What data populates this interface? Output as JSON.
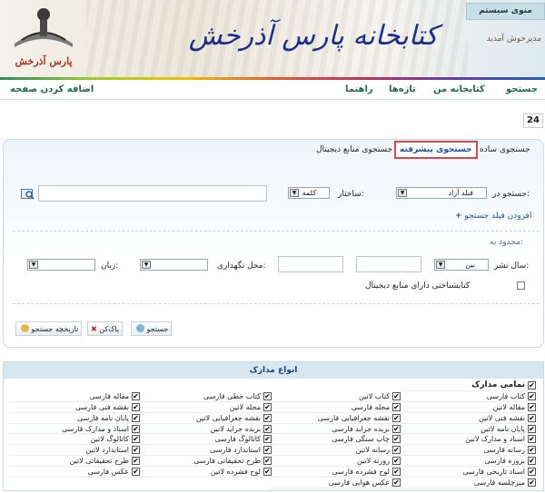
{
  "header": {
    "brand_title": "کتابخانه پارس آذرخش",
    "logo_text": "پارس آذرخش",
    "system_menu": "منوی سیستم",
    "welcome": "مدیرخوش آمدید"
  },
  "nav": {
    "search": "جستجو",
    "my_library": "کتابخانه من",
    "news": "تازه‌ها",
    "guide": "راهنما",
    "add_page": "اضافه کردن صفحه"
  },
  "page_number": "24",
  "search": {
    "tabs": {
      "simple": "جستجوی ساده",
      "advanced": "جستجوی پیشرفته",
      "digital": "جستجوی منابع دیجیتال"
    },
    "search_in_label": "جستجو در:",
    "field_select": "فیلد آزاد",
    "structure_label": "ساختار:",
    "structure_select": "کلمه",
    "add_field": "افزودن فیلد جستجو",
    "limit_label": "محدود به:",
    "year_label": "سال نشر:",
    "year_operator": "بین",
    "location_label": "محل نگهداری:",
    "language_label": "زبان:",
    "digital_only": "کتابشناختی دارای منابع دیجیتال",
    "buttons": {
      "search": "جستجو",
      "clear": "پاک‌کن",
      "history": "تاریخچه جستجو"
    }
  },
  "doc_types": {
    "title": "انواع مدارک",
    "all": "تمامی مدارک",
    "col1": [
      "کتاب فارسی",
      "مقاله لاتین",
      "نقشه فنی لاتین",
      "پایان نامه لاتین",
      "اسناد و مدارک لاتین",
      "رسانه فارسی",
      "بروزه فارسی",
      "اسناد تاریخی فارسی",
      "میزچلسه فارسی"
    ],
    "col2": [
      "کتاب لاتین",
      "مجله فارسی",
      "نقشه جغرافیایی فارسی",
      "بریده جراید فارسی",
      "چاپ سنگی فارسی",
      "رسانه لاتین",
      "روزنه لاتین",
      "لوح فشرده فارسی",
      "عکس هوایی فارسی"
    ],
    "col3": [
      "کتاب خطی فارسی",
      "مجله لاتین",
      "نقشه جغرافیایی لاتین",
      "بریده جراید لاتین",
      "کاتالوگ فارسی",
      "استاندارد فارسی",
      "طرح تحقیقاتی فارسی",
      "لوح فشرده لاتین"
    ],
    "col4": [
      "مقاله فارسی",
      "نقشه فنی فارسی",
      "پایان نامه فارسی",
      "اسناد و مدارک فارسی",
      "کاتالوگ لاتین",
      "استاندارد لاتین",
      "طرح تحقیقاتی لاتین",
      "عکس فارسی"
    ]
  },
  "colors": {
    "accent": "#1e6b4a",
    "brand": "#1d2f8a",
    "active_tab": "#e0454a"
  }
}
